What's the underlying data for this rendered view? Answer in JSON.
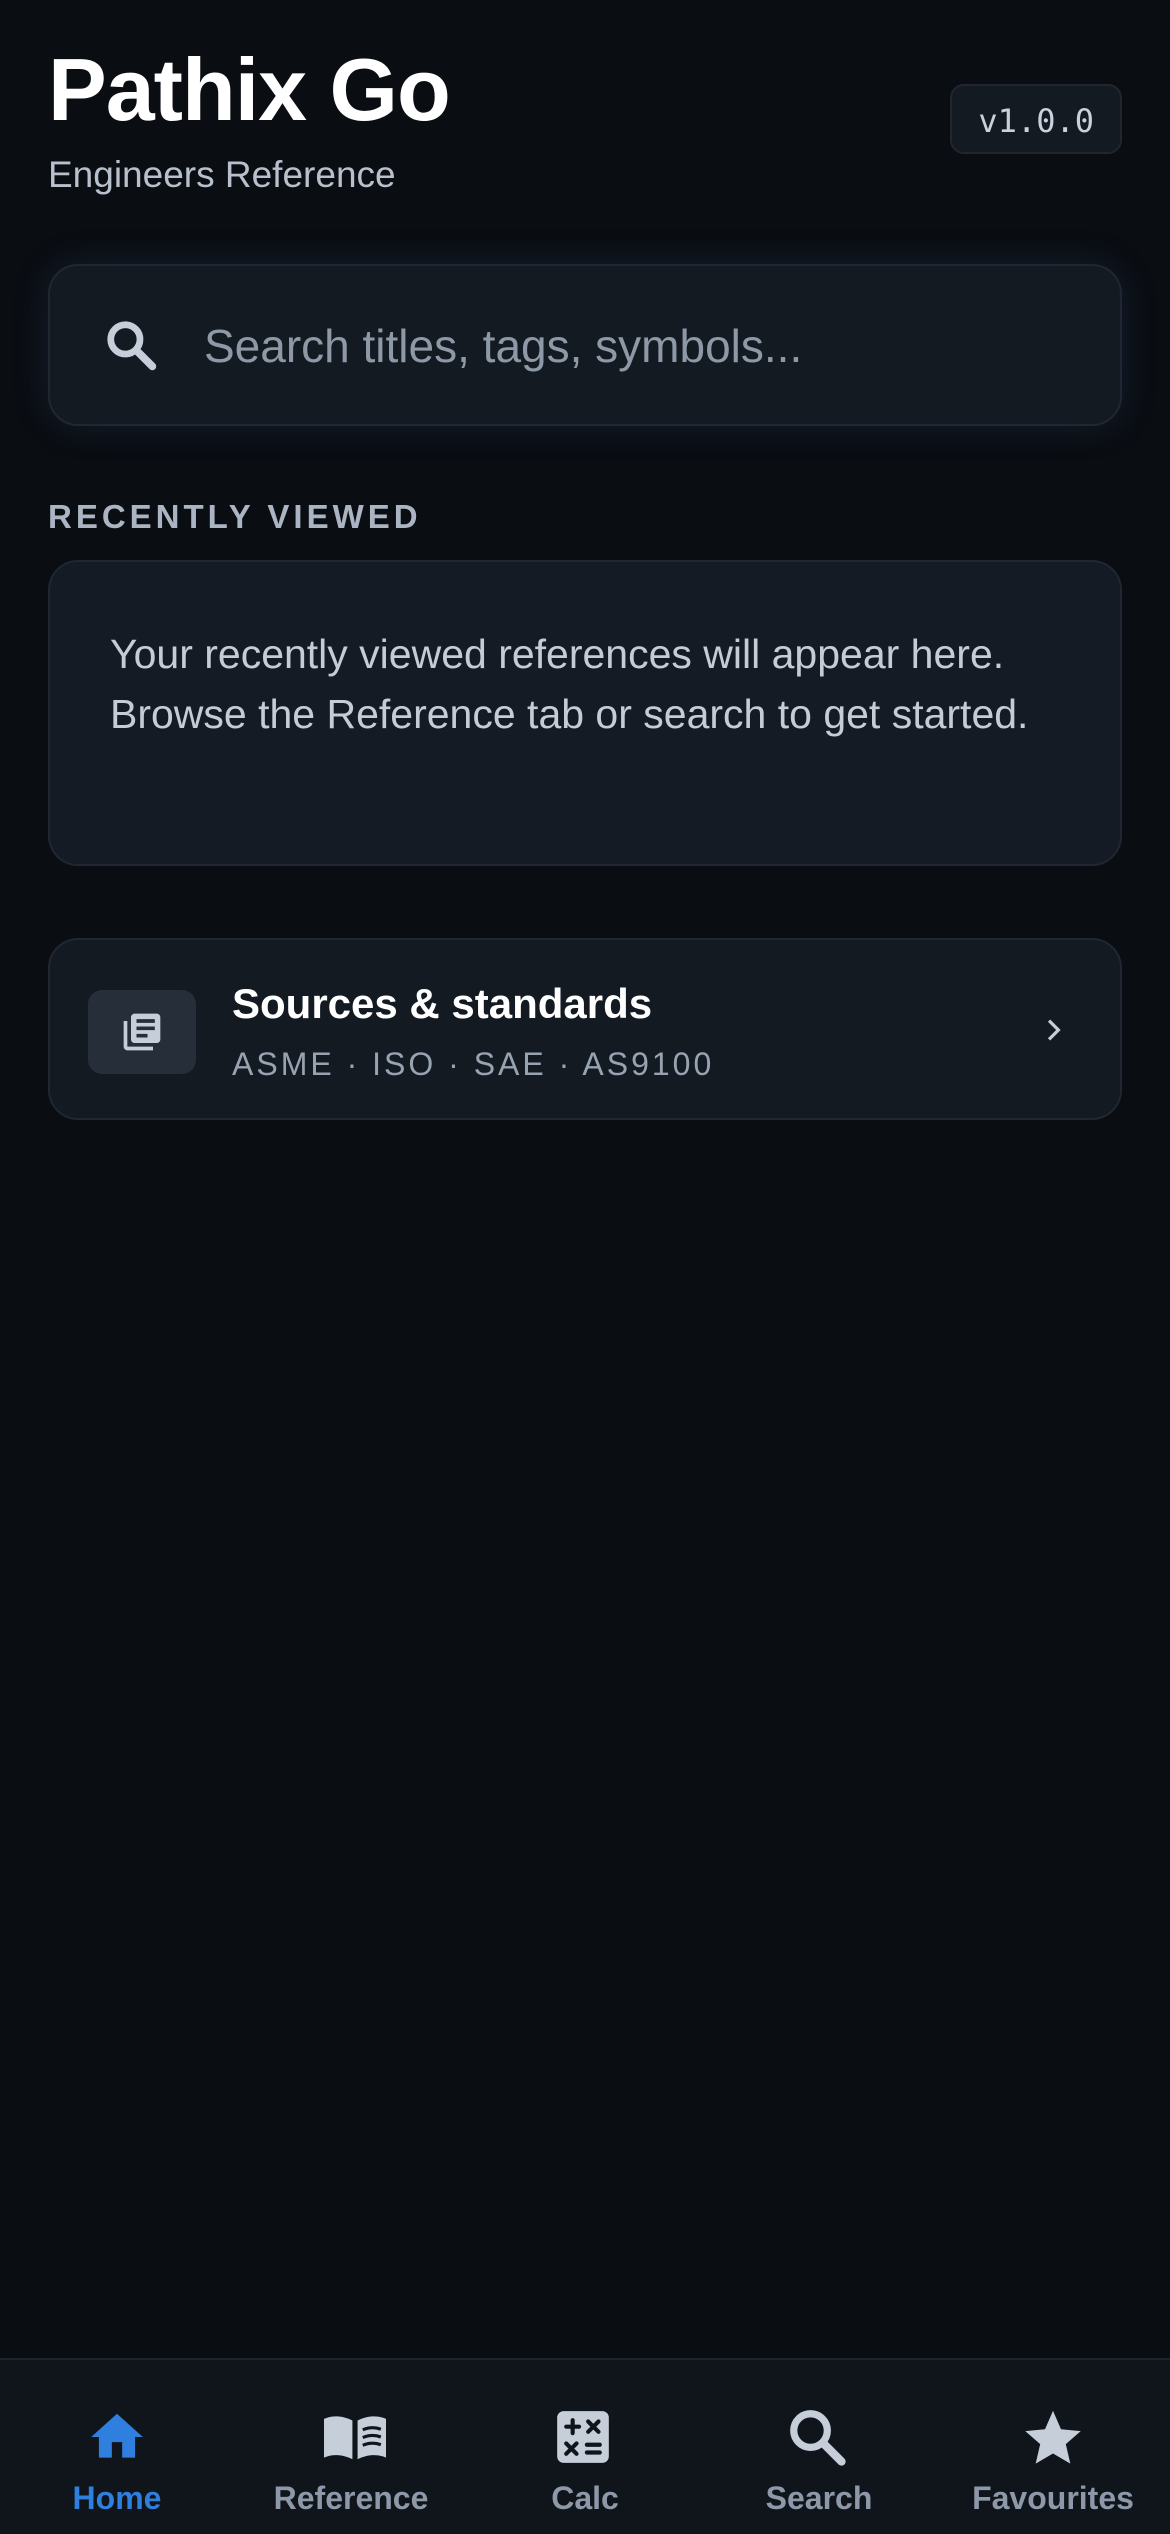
{
  "header": {
    "title": "Pathix Go",
    "subtitle": "Engineers Reference",
    "version": "v1.0.0"
  },
  "search": {
    "placeholder": "Search titles, tags, symbols...",
    "value": "",
    "icon": "search-icon"
  },
  "recently_viewed": {
    "section_label": "RECENTLY VIEWED",
    "empty_message": "Your recently viewed references will appear here. Browse the Reference tab or search to get started."
  },
  "sources": {
    "title": "Sources & standards",
    "subtitle": "ASME · ISO · SAE · AS9100",
    "icon": "library-icon"
  },
  "tab_bar": {
    "tabs": [
      {
        "label": "Home",
        "icon": "home-icon",
        "active": true
      },
      {
        "label": "Reference",
        "icon": "book-icon",
        "active": false
      },
      {
        "label": "Calc",
        "icon": "calculator-icon",
        "active": false
      },
      {
        "label": "Search",
        "icon": "search-icon",
        "active": false
      },
      {
        "label": "Favourites",
        "icon": "star-icon",
        "active": false
      }
    ]
  },
  "colors": {
    "background": "#0a0d12",
    "card": "#151b24",
    "accent": "#2f7fde",
    "inactive_tab": "#8d98a8"
  }
}
